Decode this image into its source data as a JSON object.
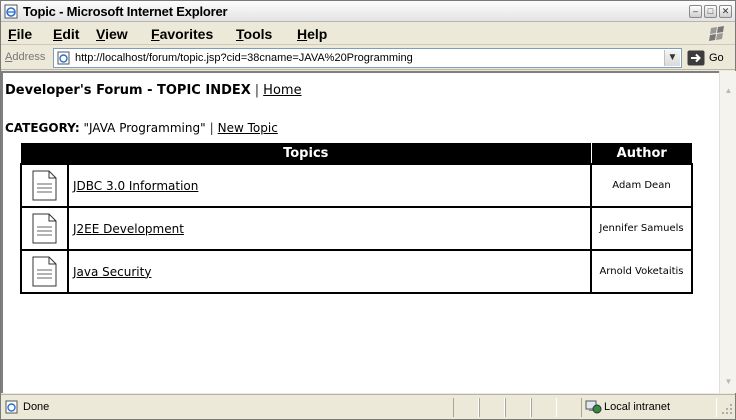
{
  "window": {
    "title": "Topic - Microsoft Internet Explorer",
    "controls": {
      "minimize": "‒",
      "maximize": "□",
      "close": "✕"
    }
  },
  "menu": {
    "items": [
      "File",
      "Edit",
      "View",
      "Favorites",
      "Tools",
      "Help"
    ]
  },
  "address": {
    "label": "Address",
    "value": "http://localhost/forum/topic.jsp?cid=38cname=JAVA%20Programming",
    "go_label": "Go"
  },
  "page": {
    "heading": "Developer's Forum - TOPIC INDEX",
    "home_link": "Home",
    "category_label": "CATEGORY:",
    "category_name": "\"JAVA Programming\"",
    "new_topic_link": "New Topic",
    "separator": "|"
  },
  "table": {
    "headers": {
      "topics": "Topics",
      "author": "Author"
    },
    "rows": [
      {
        "title": "JDBC 3.0 Information",
        "author": "Adam Dean"
      },
      {
        "title": "J2EE Development",
        "author": "Jennifer Samuels"
      },
      {
        "title": "Java Security",
        "author": "Arnold Voketaitis"
      }
    ]
  },
  "status": {
    "text": "Done",
    "zone": "Local intranet"
  },
  "icons": {
    "title": "ie-page-icon",
    "row": "document-icon",
    "go": "go-arrow-icon",
    "zone": "local-intranet-icon"
  }
}
